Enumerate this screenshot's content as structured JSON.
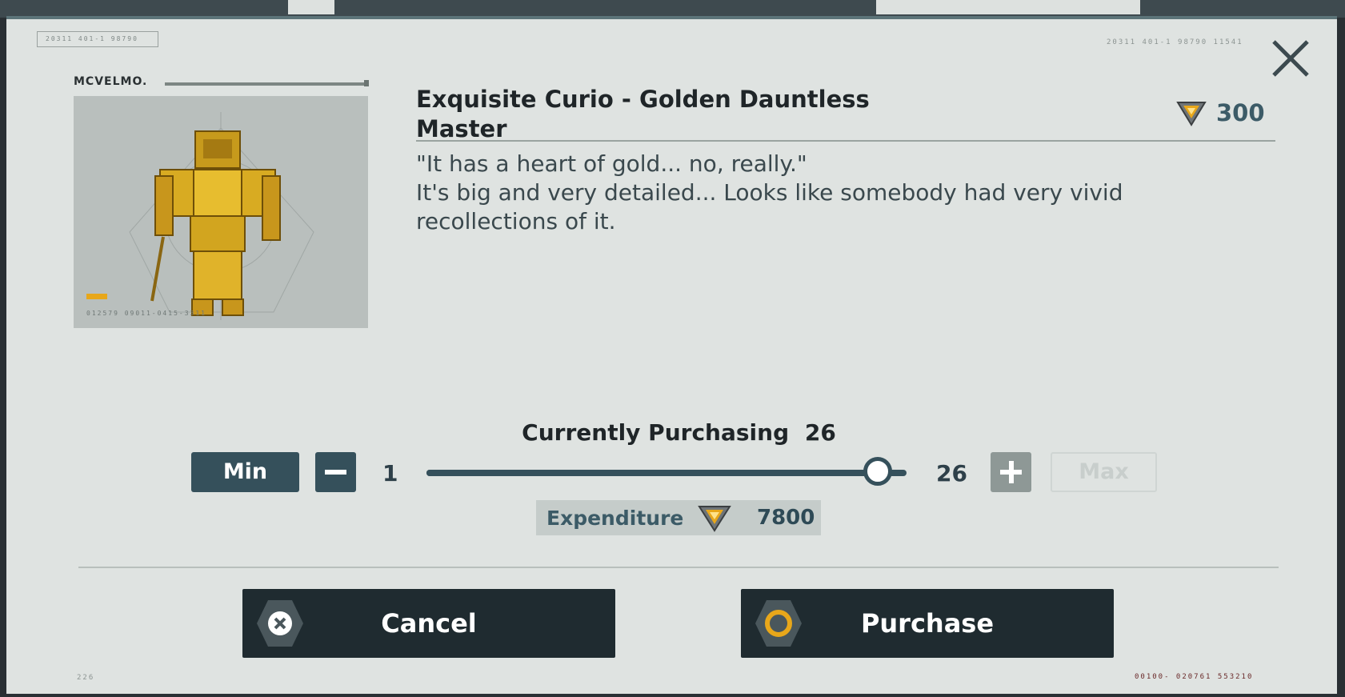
{
  "background": {
    "top_codes": "20311   401-1   98790   11541",
    "left_code": "20311   401-1   98790",
    "bottom_left_code": "226",
    "bottom_right_code": "00100- 020761 553210"
  },
  "item": {
    "brand": "MCVELMO.",
    "image_code": "012579  09011-0415-3311",
    "name": "Exquisite Curio - Golden Dauntless Master",
    "unit_price": "300",
    "description_quote": "\"It has a heart of gold... no, really.\"",
    "description_body": "It's big and very detailed... Looks like somebody had very vivid recollections of it."
  },
  "purchase": {
    "currently_label": "Currently Purchasing",
    "currently_value": "26",
    "min_label": "Min",
    "max_label": "Max",
    "min_value": "1",
    "max_value": "26",
    "slider_fraction": 0.94,
    "expenditure_label": "Expenditure",
    "expenditure_value": "7800"
  },
  "actions": {
    "cancel_label": "Cancel",
    "purchase_label": "Purchase"
  },
  "colors": {
    "accent": "#35505b",
    "currency_gold": "#e8a71a",
    "button_dark": "#1f2b30"
  },
  "icons": {
    "currency": "currency-gem-icon",
    "close": "close-icon",
    "cancel": "x-hex-icon",
    "purchase": "circle-hex-icon"
  }
}
